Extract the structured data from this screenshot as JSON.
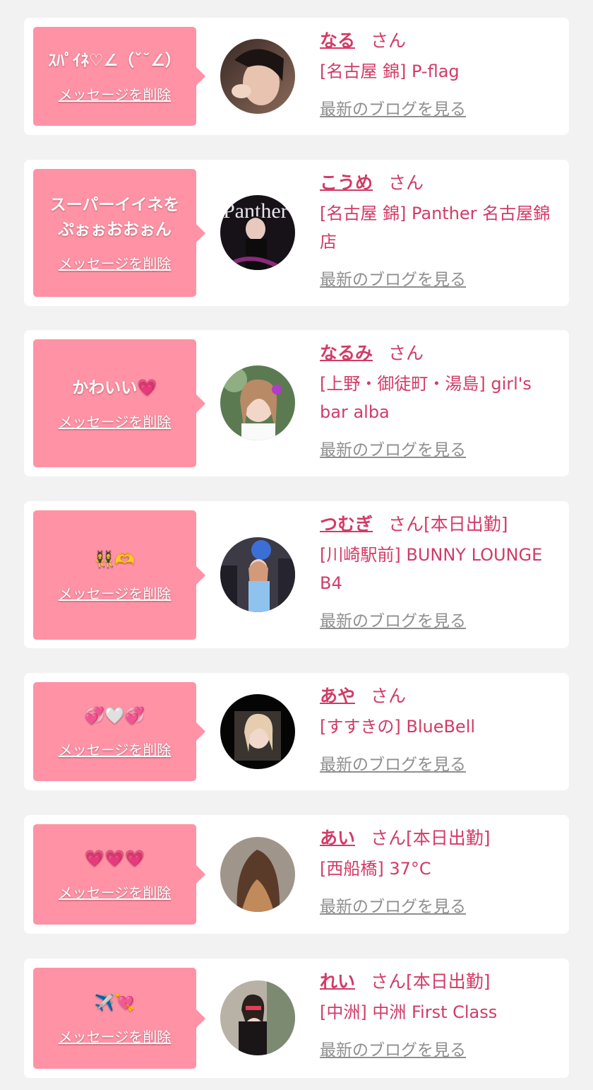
{
  "delete_label": "メッセージを削除",
  "blog_label": "最新のブログを見る",
  "honorific": "さん",
  "colors": {
    "bubble": "#ff92a5",
    "accent": "#d23b66",
    "link_gray": "#8f8f8f",
    "background": "#f2f2f2"
  },
  "messages": [
    {
      "message": "ｽﾊﾟｲﾈ♡∠（ˇ˘∠）",
      "name": "なる",
      "badge": "",
      "shop": "[名古屋 錦] P-flag"
    },
    {
      "message": "スーパーイイネを\nぷぉぉおおぉん",
      "name": "こうめ",
      "badge": "",
      "shop": "[名古屋 錦] Panther 名古屋錦店"
    },
    {
      "message": "かわいい💗",
      "name": "なるみ",
      "badge": "",
      "shop": "[上野・御徒町・湯島] girl's bar alba"
    },
    {
      "message": "👯‍♀️🫶",
      "name": "つむぎ",
      "badge": "[本日出勤]",
      "shop": "[川崎駅前] BUNNY LOUNGE B4"
    },
    {
      "message": "💞🤍💞",
      "name": "あや",
      "badge": "",
      "shop": "[すすきの] BlueBell"
    },
    {
      "message": "💗💗💗",
      "name": "あい",
      "badge": "[本日出勤]",
      "shop": "[西船橋] 37°C"
    },
    {
      "message": "✈️💘",
      "name": "れい",
      "badge": "[本日出勤]",
      "shop": "[中洲] 中洲 First Class"
    }
  ]
}
